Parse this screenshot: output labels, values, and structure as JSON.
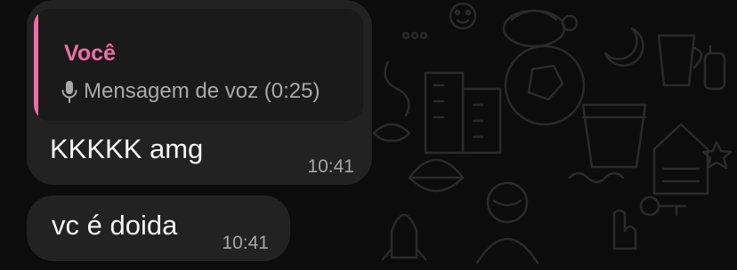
{
  "messages": [
    {
      "reply": {
        "author": "Você",
        "preview": "Mensagem de voz (0:25)",
        "icon": "mic-icon"
      },
      "text": "KKKKK amg",
      "time": "10:41"
    },
    {
      "text": "vc é doida",
      "time": "10:41"
    }
  ],
  "colors": {
    "background": "#0c0c0c",
    "bubble": "#222222",
    "quote_background": "#1a1a1a",
    "accent_pink": "#ee6da6",
    "text": "#f4f4f4",
    "muted": "#a6a6a6"
  }
}
